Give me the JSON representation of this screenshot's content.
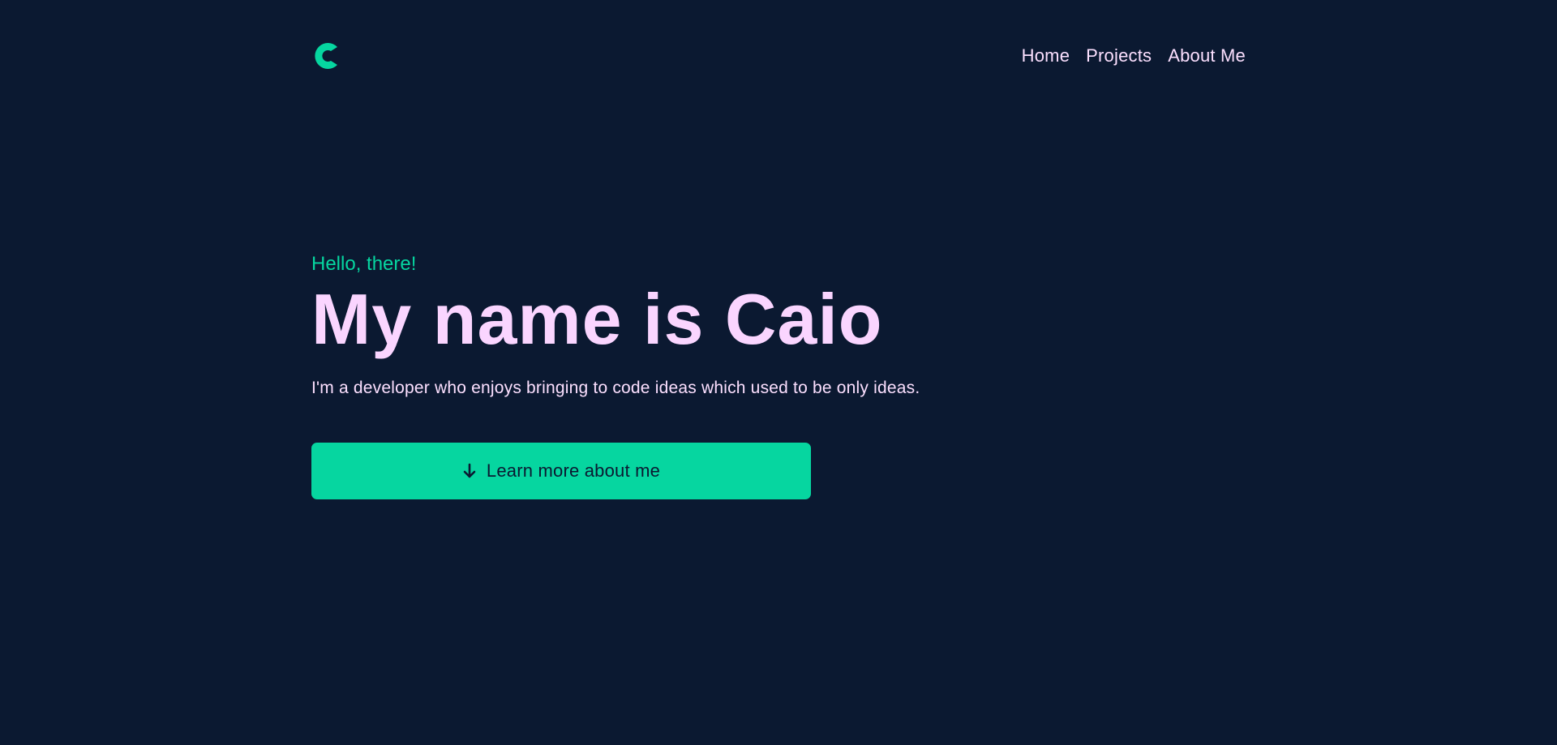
{
  "colors": {
    "background": "#0b1931",
    "accent": "#06d6a0",
    "heading": "#fad5ff",
    "text": "#fce0ff"
  },
  "header": {
    "logo_icon": "c-logo-icon",
    "nav": {
      "home": "Home",
      "projects": "Projects",
      "about": "About Me"
    }
  },
  "hero": {
    "greeting": "Hello, there!",
    "title": "My name is Caio",
    "subtitle": "I'm a developer who enjoys bringing to code ideas which used to be only ideas.",
    "cta": {
      "icon": "arrow-down-icon",
      "label": "Learn more about me"
    }
  }
}
